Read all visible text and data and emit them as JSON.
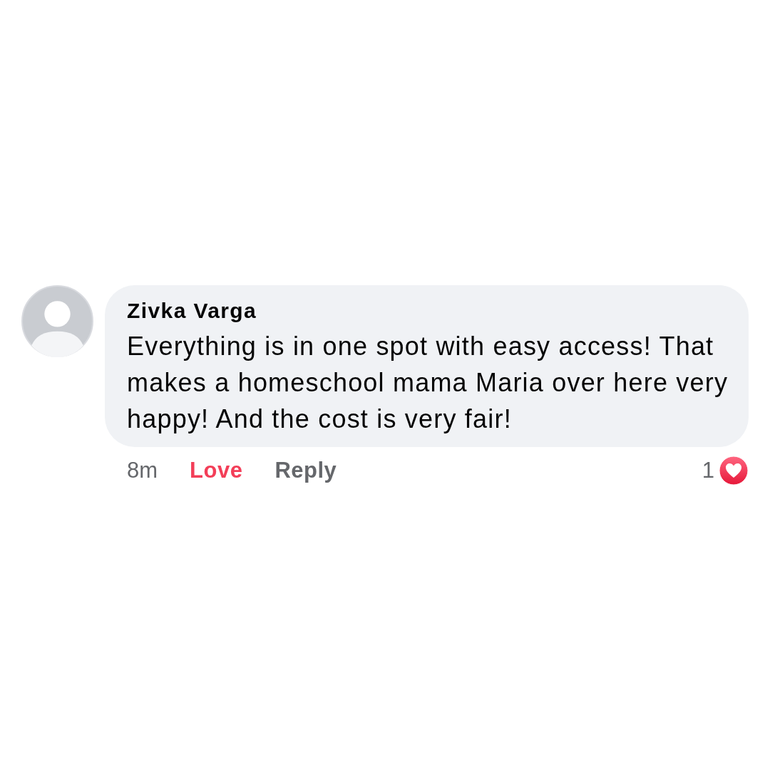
{
  "comment": {
    "author": "Zivka Varga",
    "text": "Everything is in one spot with easy access! That makes a homeschool mama Maria over here very happy! And the cost is very fair!"
  },
  "actions": [
    {
      "kind": "time",
      "label": "8m"
    },
    {
      "kind": "react",
      "label": "Love",
      "selected": true
    },
    {
      "kind": "reply",
      "label": "Reply"
    }
  ],
  "reactions": {
    "count": "1"
  }
}
